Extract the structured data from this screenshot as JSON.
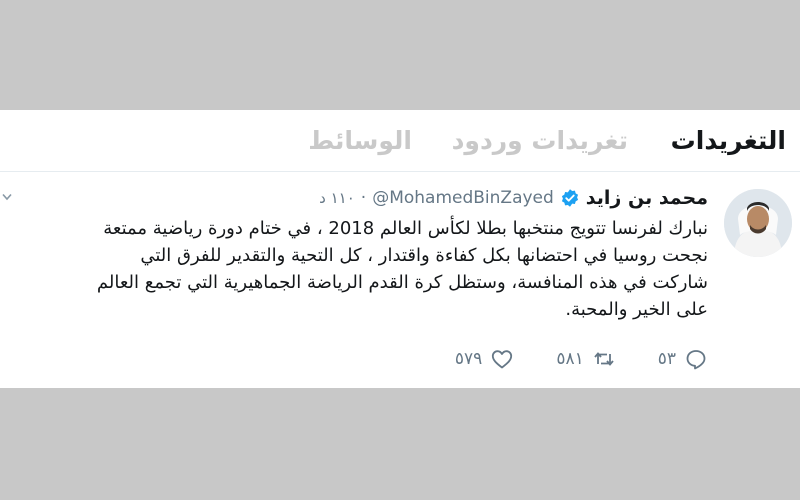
{
  "tabs": [
    {
      "label": "التغريدات",
      "active": true
    },
    {
      "label": "تغريدات وردود",
      "active": false
    },
    {
      "label": "الوسائط",
      "active": false
    }
  ],
  "tweet": {
    "author_name": "محمد بن زايد",
    "handle": "@MohamedBinZayed",
    "time": "١١٠ د",
    "verified": true,
    "lines": [
      "نبارك لفرنسا تتويج منتخبها بطلا لكأس العالم 2018 ، في ختام دورة رياضية ممتعة",
      "نجحت روسيا في احتضانها بكل كفاءة واقتدار ، كل التحية والتقدير للفرق التي",
      "شاركت في هذه المنافسة، وستظل كرة القدم الرياضة الجماهيرية التي تجمع العالم",
      "على الخير والمحبة."
    ],
    "replies": "٥٣",
    "retweets": "٥٨١",
    "likes": "٥٧٩"
  },
  "icons": {
    "verified": "verified-badge-icon",
    "reply": "reply-icon",
    "retweet": "retweet-icon",
    "like": "heart-icon",
    "more": "chevron-down-icon"
  },
  "colors": {
    "active_tab": "#14171a",
    "inactive_tab": "#c9c9c9",
    "verified": "#1da1f2",
    "muted": "#657786",
    "background": "#c8c8c8"
  }
}
